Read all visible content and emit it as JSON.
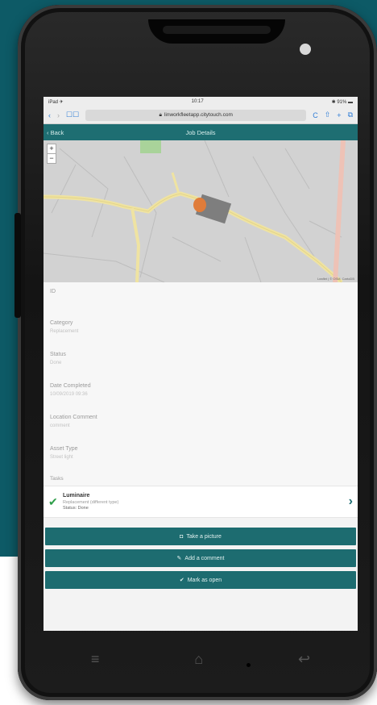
{
  "status_bar": {
    "carrier": "iPad ✈",
    "time": "10:17",
    "battery": "✱ 91% ▬"
  },
  "browser": {
    "back": "‹",
    "forward": "›",
    "bookmarks": "☐☐",
    "url": "linworkfleetapp.citytouch.com",
    "reload": "C",
    "share": "⇧",
    "add": "+",
    "tabs": "⧉"
  },
  "nav": {
    "back_label": "‹ Back",
    "title": "Job Details"
  },
  "map": {
    "zoom_in": "+",
    "zoom_out": "−",
    "attribution": "Leaflet | © OSM, CartoDB"
  },
  "fields": [
    {
      "label": "ID",
      "value": ""
    },
    {
      "label": "Category",
      "value": "Replacement"
    },
    {
      "label": "Status",
      "value": "Done"
    },
    {
      "label": "Date Completed",
      "value": "10/09/2019 09:36"
    },
    {
      "label": "Location Comment",
      "value": "comment"
    },
    {
      "label": "Asset Type",
      "value": "Street light"
    }
  ],
  "tasks_label": "Tasks",
  "task": {
    "title": "Luminaire",
    "subtitle": "Replacement (different type)",
    "status": "Status: Done"
  },
  "actions": [
    {
      "icon": "camera-icon",
      "glyph": "◘",
      "label": "Take a picture"
    },
    {
      "icon": "pencil-icon",
      "glyph": "✎",
      "label": "Add a comment"
    },
    {
      "icon": "check-icon",
      "glyph": "✔",
      "label": "Mark as open"
    }
  ],
  "hardware_nav": {
    "menu": "≡",
    "home": "⌂",
    "back": "↩"
  },
  "colors": {
    "teal_background": "#0d5a66",
    "nav_teal": "#1e6e72",
    "check_green": "#2f9e4a"
  }
}
